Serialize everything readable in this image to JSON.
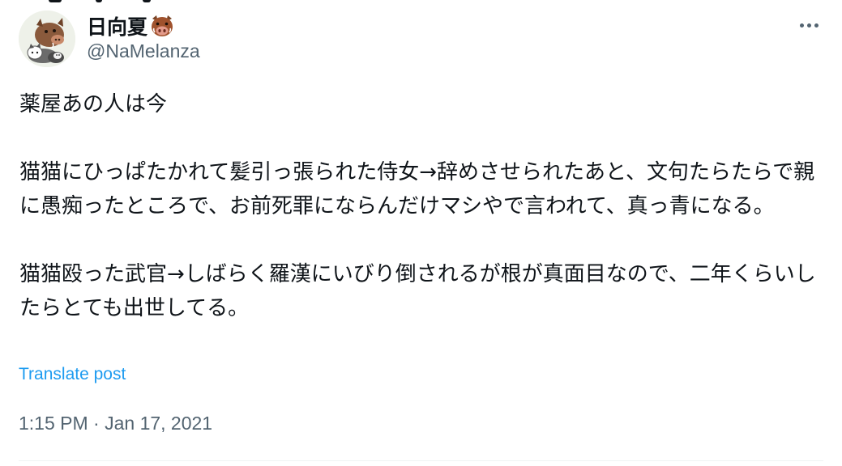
{
  "author": {
    "display_name": "日向夏",
    "handle": "@NaMelanza",
    "name_emoji_icon": "boar-icon"
  },
  "tweet": {
    "text": "薬屋あの人は今\n\n猫猫にひっぱたかれて髪引っ張られた侍女→辞めさせられたあと、文句たらたらで親に愚痴ったところで、お前死罪にならんだけマシやで言われて、真っ青になる。\n\n猫猫殴った武官→しばらく羅漢にいびり倒されるが根が真面目なので、二年くらいしたらとても出世してる。",
    "translate_label": "Translate post",
    "timestamp": "1:15 PM · Jan 17, 2021"
  },
  "icons": {
    "more": "more-horizontal-icon",
    "avatar": "avatar-boar-cats-illustration"
  },
  "colors": {
    "text_primary": "#0f1419",
    "text_secondary": "#536471",
    "link": "#1d9bf0",
    "divider": "#eff3f4"
  }
}
